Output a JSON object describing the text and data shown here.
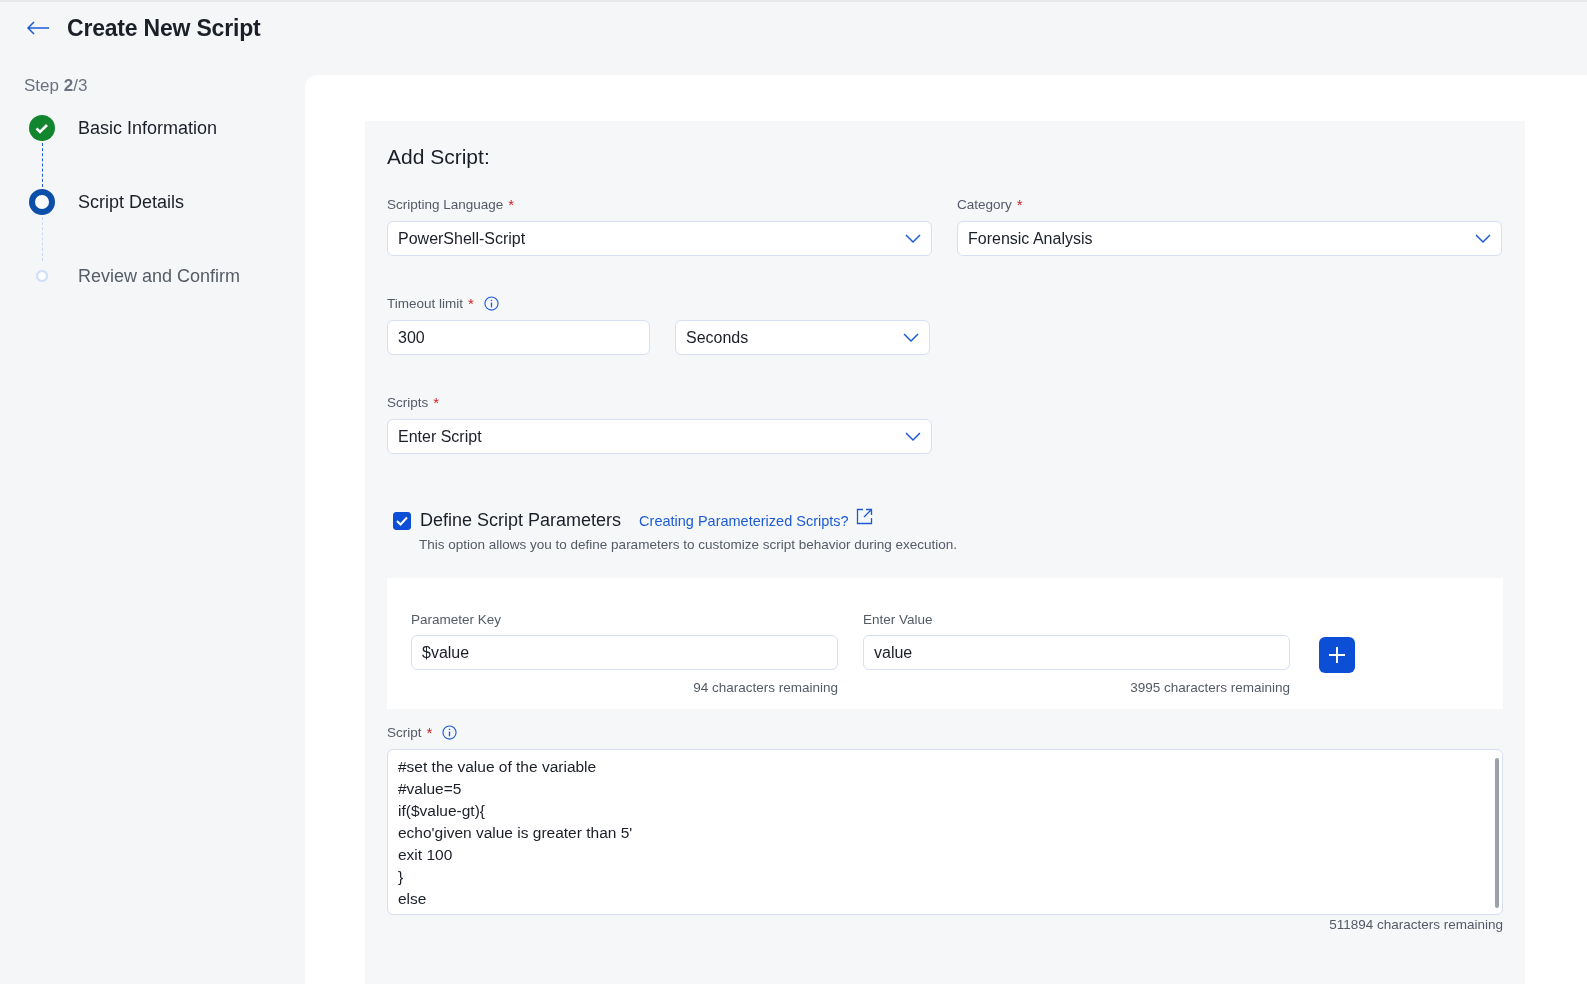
{
  "header": {
    "title": "Create New Script"
  },
  "stepper": {
    "progress": "Step **2**/3",
    "steps": [
      {
        "label": "Basic Information",
        "kind": "done"
      },
      {
        "label": "Script Details",
        "kind": "current"
      },
      {
        "label": "Review and Confirm",
        "kind": "pending"
      }
    ]
  },
  "form": {
    "heading": "Add Script:",
    "scripting_language": {
      "label": "Scripting Language",
      "required_mark": "*",
      "value": "PowerShell-Script"
    },
    "category": {
      "label": "Category",
      "required_mark": "*",
      "value": "Forensic Analysis"
    },
    "timeout": {
      "label": "Timeout limit",
      "required_mark": "*",
      "info": true,
      "value": "300",
      "unit": "Seconds"
    },
    "scripts": {
      "label": "Scripts",
      "required_mark": "*",
      "value": "Enter Script"
    },
    "parameters": {
      "checked": true,
      "label": "Define Script Parameters",
      "link": "Creating Parameterized Scripts?",
      "description": "This option allows you to define parameters to customize script behavior during execution.",
      "key": {
        "label": "Parameter Key",
        "value": "$value",
        "remaining": "94 characters remaining"
      },
      "value": {
        "label": "Enter Value",
        "value": "value",
        "remaining": "3995 characters remaining"
      }
    },
    "script": {
      "label": "Script",
      "required_mark": "*",
      "info": true,
      "lines": [
        "#set the value of the variable",
        "#value=5",
        "if($value-gt){",
        "echo'given value is greater than 5'",
        "exit 100",
        "}",
        "else"
      ],
      "remaining": "511894 characters remaining"
    }
  }
}
